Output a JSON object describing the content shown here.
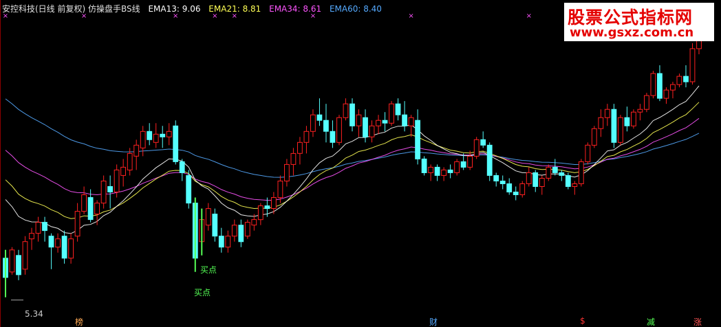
{
  "header": {
    "title": "安控科技(日线 前复权) 仿操盘手BS线",
    "ema13": "EMA13: 9.06",
    "ema21": "EMA21: 8.81",
    "ema34": "EMA34: 8.61",
    "ema60": "EMA60: 8.40"
  },
  "watermark": {
    "line1": "股票公式指标网",
    "line2": "www.gsxz.com.cn"
  },
  "colors": {
    "background": "#000000",
    "up": "#ff2020",
    "down": "#55ffff",
    "ema13": "#ffffff",
    "ema21": "#ffff55",
    "ema34": "#ff55ff",
    "ema60": "#55aaff",
    "signal": "#55ff55",
    "watermark": "#e50000"
  },
  "annotations": {
    "buy1": "买点",
    "buy2": "买点",
    "low_label": "5.34",
    "event_bang": "榜",
    "event_cai": "财",
    "event_dollar": "$",
    "event_jian": "减",
    "event_zhang": "涨"
  },
  "chart_data": {
    "type": "candlestick",
    "title": "安控科技(日线 前复权) 仿操盘手BS线",
    "ylim": [
      4.95,
      10.36
    ],
    "low_marker": 5.34,
    "series": [
      {
        "name": "EMA13",
        "value": 9.06
      },
      {
        "name": "EMA21",
        "value": 8.81
      },
      {
        "name": "EMA34",
        "value": 8.61
      },
      {
        "name": "EMA60",
        "value": 8.4
      }
    ],
    "candles": [
      [
        5.9,
        6.05,
        5.34,
        5.55
      ],
      [
        5.65,
        6.1,
        5.6,
        6.05
      ],
      [
        5.95,
        6.05,
        5.5,
        5.6
      ],
      [
        5.7,
        6.3,
        5.6,
        6.2
      ],
      [
        6.25,
        6.45,
        6.05,
        6.35
      ],
      [
        6.35,
        6.65,
        6.2,
        6.55
      ],
      [
        6.55,
        6.65,
        6.2,
        6.4
      ],
      [
        6.3,
        6.35,
        5.7,
        6.1
      ],
      [
        6.1,
        6.35,
        6.0,
        6.25
      ],
      [
        6.3,
        6.4,
        5.8,
        5.9
      ],
      [
        5.9,
        6.35,
        5.8,
        6.25
      ],
      [
        6.3,
        6.9,
        6.2,
        6.75
      ],
      [
        6.75,
        7.2,
        6.7,
        7.05
      ],
      [
        7.0,
        7.15,
        6.55,
        6.6
      ],
      [
        6.7,
        6.95,
        6.5,
        6.9
      ],
      [
        6.9,
        7.4,
        6.8,
        7.3
      ],
      [
        7.2,
        7.4,
        6.8,
        7.1
      ],
      [
        7.1,
        7.6,
        7.0,
        7.5
      ],
      [
        7.4,
        7.7,
        7.2,
        7.55
      ],
      [
        7.5,
        7.9,
        7.4,
        7.8
      ],
      [
        7.75,
        8.05,
        7.5,
        7.95
      ],
      [
        7.9,
        8.3,
        7.75,
        8.2
      ],
      [
        8.2,
        8.35,
        7.95,
        8.05
      ],
      [
        8.0,
        8.35,
        7.9,
        8.15
      ],
      [
        8.15,
        8.3,
        7.9,
        8.1
      ],
      [
        8.1,
        8.35,
        7.95,
        8.2
      ],
      [
        8.3,
        8.4,
        7.6,
        7.65
      ],
      [
        7.65,
        7.7,
        7.3,
        7.45
      ],
      [
        7.4,
        7.5,
        6.8,
        6.9
      ],
      [
        6.9,
        7.0,
        5.8,
        5.9
      ],
      [
        6.2,
        6.8,
        6.1,
        6.6
      ],
      [
        6.5,
        6.9,
        6.4,
        6.8
      ],
      [
        6.7,
        6.8,
        6.2,
        6.3
      ],
      [
        6.3,
        6.45,
        6.0,
        6.1
      ],
      [
        6.1,
        6.4,
        6.0,
        6.3
      ],
      [
        6.3,
        6.6,
        6.2,
        6.5
      ],
      [
        6.5,
        6.6,
        6.1,
        6.2
      ],
      [
        6.3,
        6.6,
        6.25,
        6.55
      ],
      [
        6.5,
        6.7,
        6.4,
        6.6
      ],
      [
        6.6,
        6.9,
        6.5,
        6.85
      ],
      [
        6.85,
        7.0,
        6.65,
        6.8
      ],
      [
        6.8,
        7.1,
        6.7,
        7.0
      ],
      [
        7.0,
        7.4,
        6.9,
        7.3
      ],
      [
        7.3,
        7.7,
        7.2,
        7.6
      ],
      [
        7.6,
        7.9,
        7.4,
        7.8
      ],
      [
        7.8,
        8.1,
        7.6,
        8.0
      ],
      [
        8.0,
        8.3,
        7.8,
        8.2
      ],
      [
        8.2,
        8.6,
        8.1,
        8.5
      ],
      [
        8.5,
        8.8,
        8.3,
        8.4
      ],
      [
        8.4,
        8.7,
        8.0,
        8.2
      ],
      [
        8.2,
        8.4,
        7.9,
        8.0
      ],
      [
        8.0,
        8.5,
        7.95,
        8.45
      ],
      [
        8.45,
        8.8,
        8.4,
        8.7
      ],
      [
        8.7,
        8.8,
        8.2,
        8.3
      ],
      [
        8.3,
        8.6,
        8.1,
        8.5
      ],
      [
        8.45,
        8.6,
        8.0,
        8.1
      ],
      [
        8.1,
        8.4,
        8.0,
        8.3
      ],
      [
        8.3,
        8.5,
        8.15,
        8.4
      ],
      [
        8.4,
        8.55,
        8.2,
        8.35
      ],
      [
        8.35,
        8.75,
        8.3,
        8.7
      ],
      [
        8.7,
        8.8,
        8.4,
        8.5
      ],
      [
        8.5,
        8.75,
        8.2,
        8.3
      ],
      [
        8.3,
        8.5,
        8.1,
        8.45
      ],
      [
        8.4,
        8.6,
        7.6,
        7.7
      ],
      [
        7.7,
        7.75,
        7.4,
        7.45
      ],
      [
        7.45,
        7.6,
        7.3,
        7.55
      ],
      [
        7.55,
        7.6,
        7.3,
        7.4
      ],
      [
        7.4,
        7.55,
        7.3,
        7.5
      ],
      [
        7.5,
        7.6,
        7.35,
        7.45
      ],
      [
        7.45,
        7.7,
        7.4,
        7.65
      ],
      [
        7.65,
        7.8,
        7.5,
        7.55
      ],
      [
        7.55,
        7.85,
        7.5,
        7.75
      ],
      [
        7.75,
        8.1,
        7.7,
        8.05
      ],
      [
        8.05,
        8.2,
        7.9,
        7.95
      ],
      [
        7.95,
        8.0,
        7.3,
        7.4
      ],
      [
        7.4,
        7.45,
        7.2,
        7.3
      ],
      [
        7.3,
        7.4,
        7.15,
        7.25
      ],
      [
        7.25,
        7.35,
        7.05,
        7.1
      ],
      [
        7.1,
        7.2,
        6.95,
        7.05
      ],
      [
        7.05,
        7.3,
        7.0,
        7.25
      ],
      [
        7.25,
        7.55,
        7.2,
        7.45
      ],
      [
        7.45,
        7.5,
        7.1,
        7.2
      ],
      [
        7.2,
        7.4,
        7.05,
        7.35
      ],
      [
        7.35,
        7.6,
        7.3,
        7.55
      ],
      [
        7.55,
        7.7,
        7.4,
        7.45
      ],
      [
        7.45,
        7.5,
        7.3,
        7.4
      ],
      [
        7.4,
        7.45,
        7.15,
        7.2
      ],
      [
        7.2,
        7.3,
        7.05,
        7.25
      ],
      [
        7.25,
        7.7,
        7.2,
        7.65
      ],
      [
        7.65,
        8.0,
        7.6,
        7.95
      ],
      [
        7.95,
        8.3,
        7.9,
        8.25
      ],
      [
        8.25,
        8.6,
        8.1,
        8.45
      ],
      [
        8.45,
        8.7,
        8.3,
        8.6
      ],
      [
        8.6,
        8.7,
        7.9,
        8.0
      ],
      [
        8.0,
        8.5,
        7.95,
        8.45
      ],
      [
        8.45,
        8.65,
        8.2,
        8.3
      ],
      [
        8.3,
        8.6,
        8.25,
        8.55
      ],
      [
        8.55,
        8.7,
        8.4,
        8.6
      ],
      [
        8.6,
        8.9,
        8.55,
        8.85
      ],
      [
        8.85,
        9.3,
        8.8,
        9.25
      ],
      [
        9.25,
        9.4,
        8.75,
        8.8
      ],
      [
        8.8,
        9.0,
        8.7,
        8.95
      ],
      [
        8.95,
        9.1,
        8.8,
        9.05
      ],
      [
        9.05,
        9.25,
        9.0,
        9.2
      ],
      [
        9.2,
        9.4,
        9.0,
        9.1
      ],
      [
        9.1,
        9.8,
        9.05,
        9.7
      ],
      [
        9.7,
        10.2,
        9.6,
        9.9
      ]
    ]
  }
}
